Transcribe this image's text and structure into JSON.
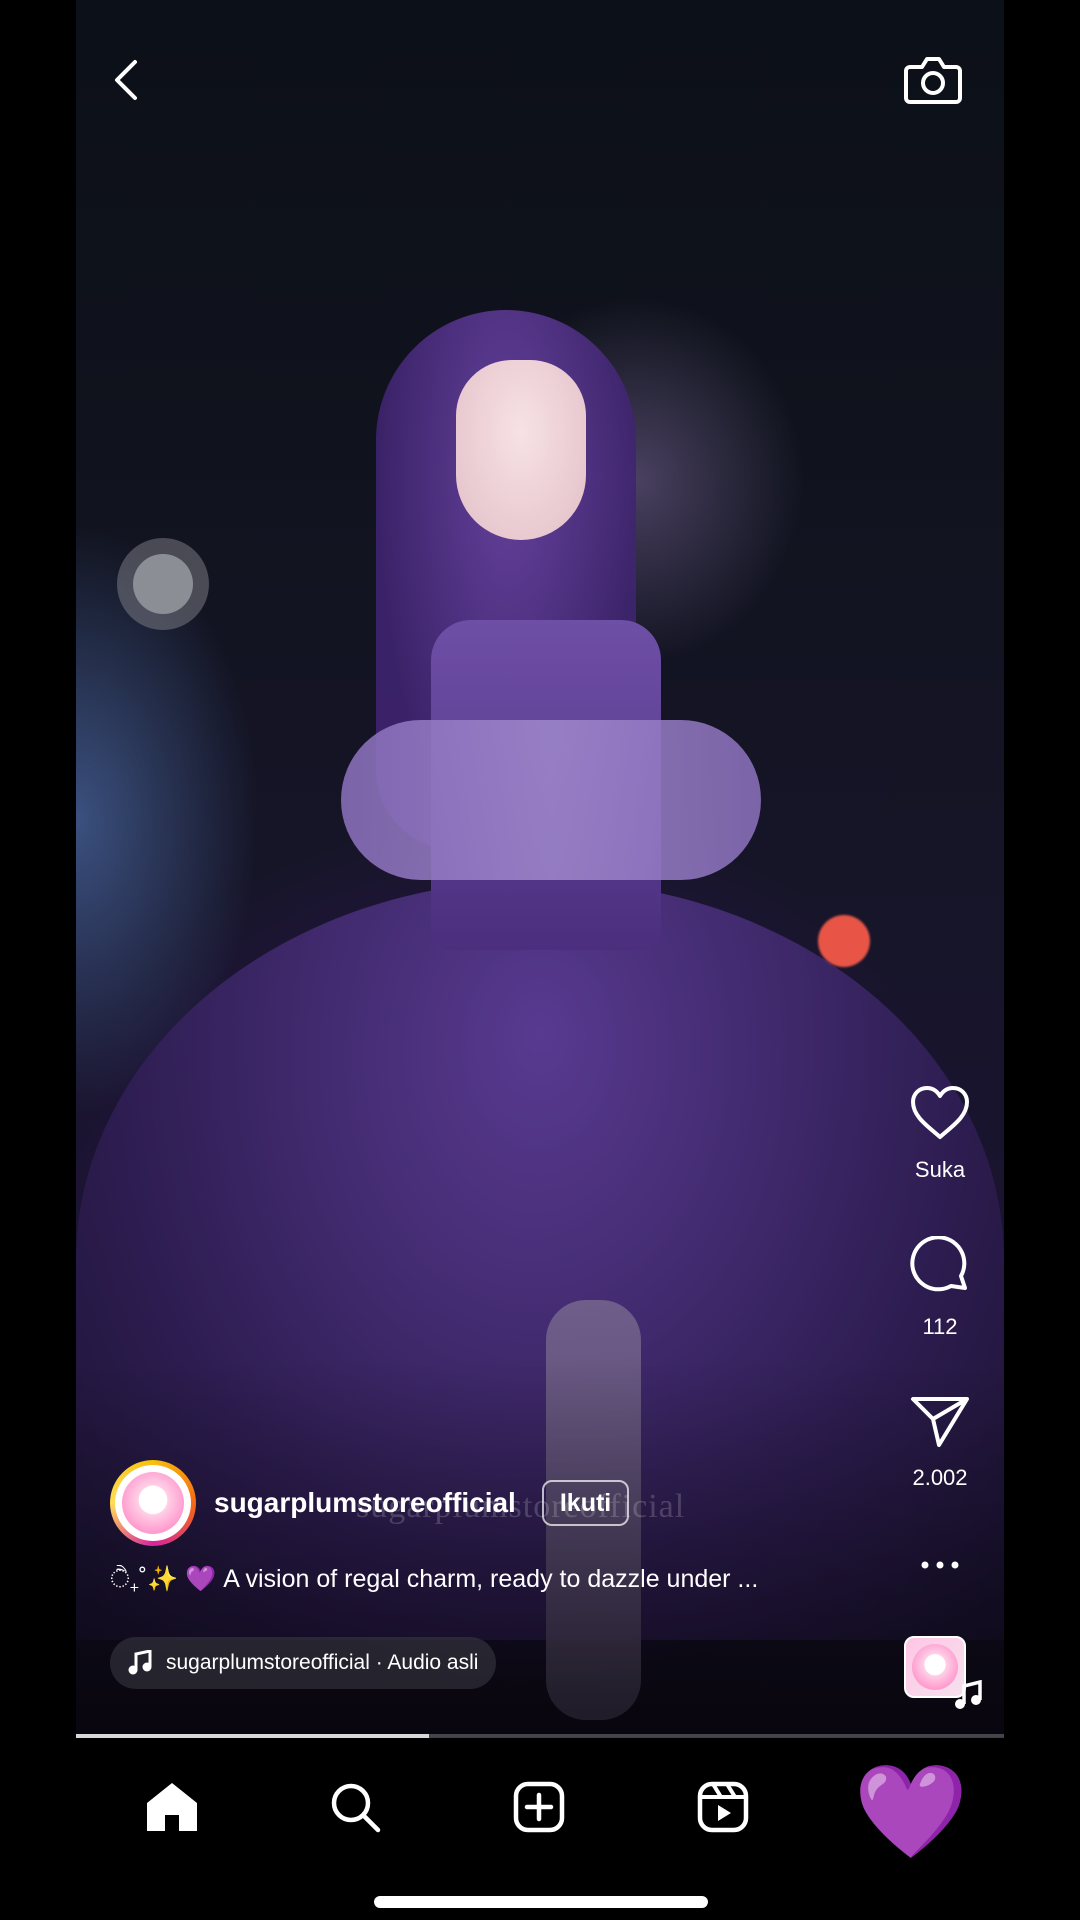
{
  "header": {
    "back_icon": "chevron-left-icon",
    "camera_icon": "camera-icon"
  },
  "actions": {
    "like_label": "Suka",
    "comments_count": "112",
    "shares_count": "2.002",
    "more_icon": "ellipsis-icon"
  },
  "post": {
    "username": "sugarplumstoreofficial",
    "follow_label": "Ikuti",
    "watermark": "sugarplumstoreofficial",
    "caption_prefix": "ੈ₊˚✨",
    "caption_heart": "💜",
    "caption_text": "A vision of regal charm, ready to dazzle under ..."
  },
  "audio": {
    "label": "sugarplumstoreofficial · Audio asli"
  },
  "playback": {
    "progress_fraction": 0.38
  },
  "nav": {
    "profile_emoji": "💜"
  }
}
